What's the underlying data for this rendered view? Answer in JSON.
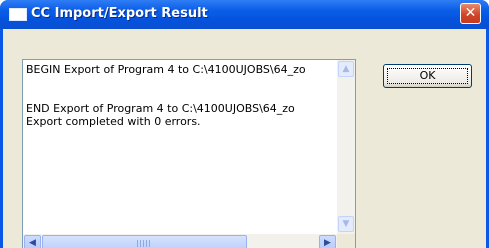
{
  "window": {
    "title": "CC Import/Export Result",
    "close_glyph": "✕"
  },
  "log": {
    "lines": [
      "BEGIN Export of Program 4 to C:\\4100UJOBS\\64_zo",
      "",
      "",
      "END Export of Program 4 to C:\\4100UJOBS\\64_zo",
      "Export completed with 0 errors."
    ]
  },
  "buttons": {
    "ok_label": "OK"
  },
  "icons": {
    "title": "window-app-icon",
    "close": "close-icon",
    "scroll_up": "scroll-up-arrow-icon",
    "scroll_down": "scroll-down-arrow-icon",
    "scroll_left": "scroll-left-arrow-icon",
    "scroll_right": "scroll-right-arrow-icon"
  },
  "colors": {
    "titlebar": "#0553dc",
    "dialog_background": "#ece9d8",
    "close_button": "#d2452a"
  }
}
